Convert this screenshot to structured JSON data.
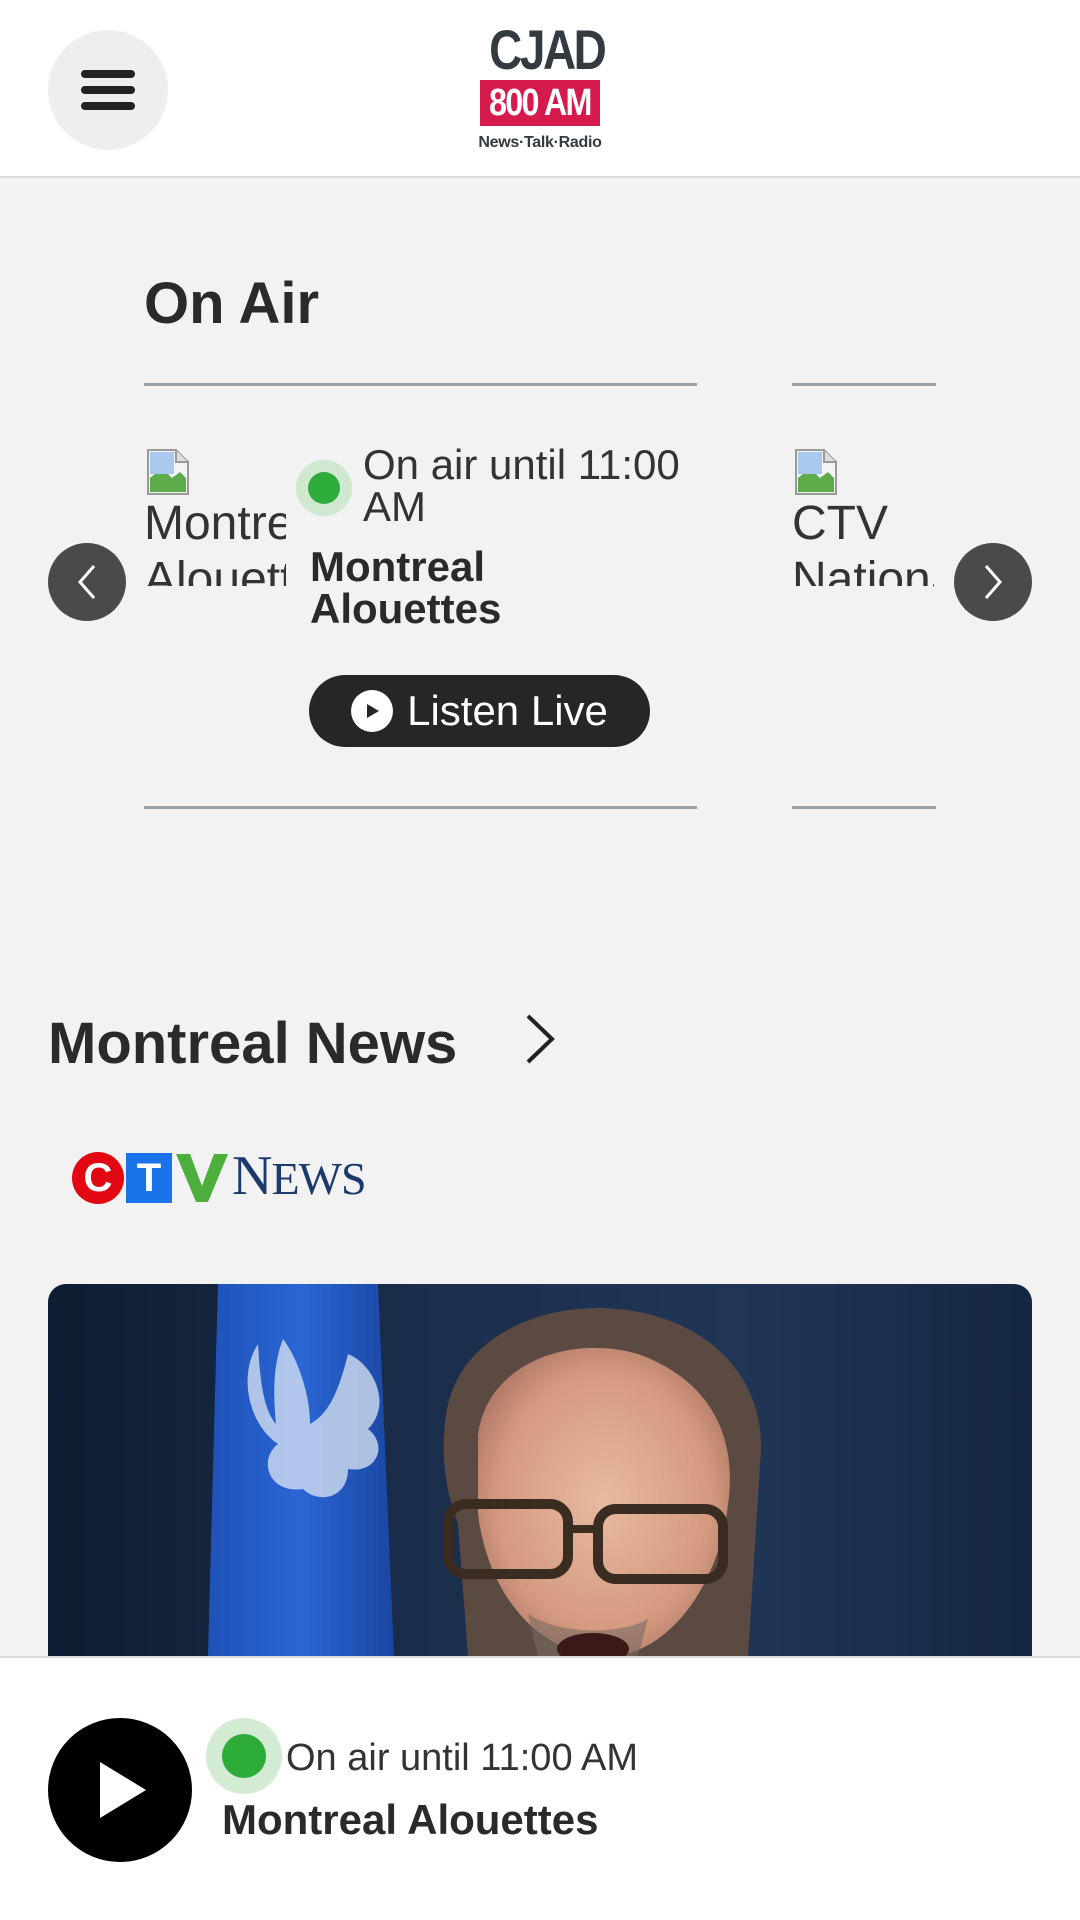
{
  "header": {
    "logo": {
      "line1": "CJAD",
      "line2": "800 AM",
      "line3": "News·Talk·Radio"
    }
  },
  "on_air": {
    "title": "On Air",
    "cards": [
      {
        "image_alt": "Montreal Alouettes",
        "status": "On air until 11:00 AM",
        "show": "Montreal Alouettes",
        "listen_label": "Listen Live"
      },
      {
        "image_alt": "CTV National"
      }
    ]
  },
  "news": {
    "title": "Montreal News",
    "source_logo": {
      "c": "C",
      "t": "T",
      "v": "V",
      "news_first": "N",
      "news_rest": "EWS"
    }
  },
  "player": {
    "status": "On air until 11:00 AM",
    "show": "Montreal Alouettes"
  },
  "colors": {
    "live_green": "#2eac3a",
    "brand_red": "#d61a4c",
    "ctv_red": "#e30613",
    "ctv_blue": "#1a73e8",
    "ctv_green": "#4caf3c",
    "ctv_navy": "#1b3a6b"
  }
}
